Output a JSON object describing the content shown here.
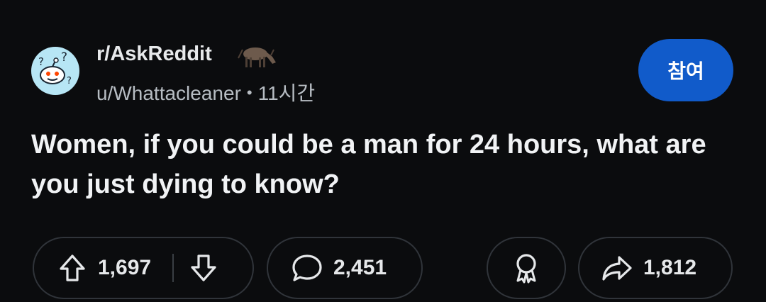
{
  "post": {
    "subreddit": "r/AskReddit",
    "author": "u/Whattacleaner",
    "separator": "•",
    "time": "11시간",
    "title": "Women, if you could be a man for 24 hours, what are you just dying to know?"
  },
  "actions": {
    "join_label": "참여",
    "upvotes": "1,697",
    "comments": "2,451",
    "shares": "1,812"
  },
  "colors": {
    "background": "#0b0c0e",
    "join_button": "#115bca",
    "pill_border": "#30343a",
    "avatar_bg": "#b7e6f5"
  },
  "icons": {
    "subreddit": "askreddit-snoo-icon",
    "flair": "donkey-flair-icon",
    "upvote": "upvote-arrow-icon",
    "downvote": "downvote-arrow-icon",
    "comment": "comment-bubble-icon",
    "award": "award-ribbon-icon",
    "share": "share-arrow-icon"
  }
}
